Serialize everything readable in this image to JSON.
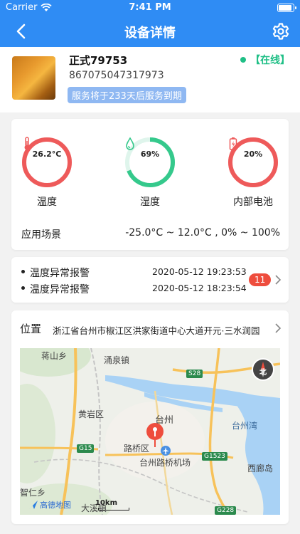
{
  "status_bar": {
    "carrier": "Carrier",
    "time": "7:41 PM"
  },
  "nav": {
    "title": "设备详情",
    "back_icon": "chevron-left-icon",
    "settings_icon": "gear-icon"
  },
  "device": {
    "name": "正式79753",
    "id": "867075047317973",
    "service_notice": "服务将于233天后服务到期",
    "status": "【在线】",
    "status_color": "#1fbf86"
  },
  "sensors": [
    {
      "value": "26.2°C",
      "label": "温度",
      "icon": "thermometer-icon",
      "level": 1.0,
      "color": "#ee5a5a"
    },
    {
      "value": "69%",
      "label": "湿度",
      "icon": "water-drop-icon",
      "level": 0.69,
      "color": "#35c98c"
    },
    {
      "value": "20%",
      "label": "内部电池",
      "icon": "battery-charging-icon",
      "level": 1.0,
      "color": "#ee5a5a"
    }
  ],
  "scene": {
    "label": "应用场景",
    "value": "-25.0°C ~ 12.0°C , 0% ~ 100%"
  },
  "alarms": {
    "items": [
      {
        "text": "温度异常报警",
        "time": "2020-05-12 19:23:53"
      },
      {
        "text": "温度异常报警",
        "time": "2020-05-12 18:23:54"
      }
    ],
    "count": "11",
    "badge_color": "#ee4d3d"
  },
  "location": {
    "label": "位置",
    "address": "浙江省台州市椒江区洪家街道中心大道开元·三水润园",
    "map": {
      "places": [
        "蒋山乡",
        "涌泉镇",
        "黄岩区",
        "台州",
        "路桥区",
        "台州路桥机场",
        "台州湾",
        "西廊岛",
        "智仁乡",
        "大溪镇"
      ],
      "road_signs": [
        "S28",
        "G15",
        "G1523",
        "G228"
      ],
      "scale": "10km",
      "logo": "高德地图",
      "compass": "北"
    }
  }
}
